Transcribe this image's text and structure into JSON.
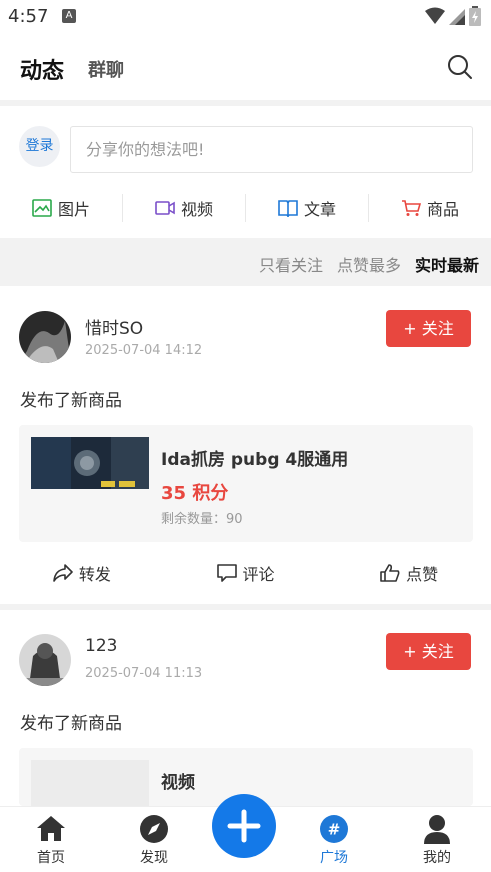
{
  "status_bar": {
    "time": "4:57",
    "app_badge": "A"
  },
  "header": {
    "active_tab": "动态",
    "other_tab": "群聊"
  },
  "compose": {
    "login_label": "登录",
    "placeholder": "分享你的想法吧!",
    "actions": [
      {
        "label": "图片",
        "icon": "image-icon"
      },
      {
        "label": "视频",
        "icon": "video-icon"
      },
      {
        "label": "文章",
        "icon": "book-icon"
      },
      {
        "label": "商品",
        "icon": "cart-icon"
      }
    ]
  },
  "filters": [
    {
      "label": "只看关注",
      "active": false
    },
    {
      "label": "点赞最多",
      "active": false
    },
    {
      "label": "实时最新",
      "active": true
    }
  ],
  "posts": [
    {
      "username": "惜时SO",
      "time": "2025-07-04 14:12",
      "follow_label": "+ 关注",
      "text": "发布了新商品",
      "product": {
        "name": "Ida抓房 pubg 4服通用",
        "price": "35 积分",
        "stock": "剩余数量：90"
      },
      "actions": [
        "转发",
        "评论",
        "点赞"
      ]
    },
    {
      "username": "123",
      "time": "2025-07-04 11:13",
      "follow_label": "+ 关注",
      "text": "发布了新商品",
      "product": {
        "name": "视频"
      }
    }
  ],
  "bottom_nav": [
    {
      "label": "首页",
      "icon": "home-icon",
      "active": false
    },
    {
      "label": "发现",
      "icon": "compass-icon",
      "active": false
    },
    {
      "label": "广场",
      "icon": "hash-icon",
      "active": true
    },
    {
      "label": "我的",
      "icon": "person-icon",
      "active": false
    }
  ],
  "colors": {
    "accent": "#1479e8",
    "follow": "#e8473f",
    "price": "#e8473f"
  }
}
